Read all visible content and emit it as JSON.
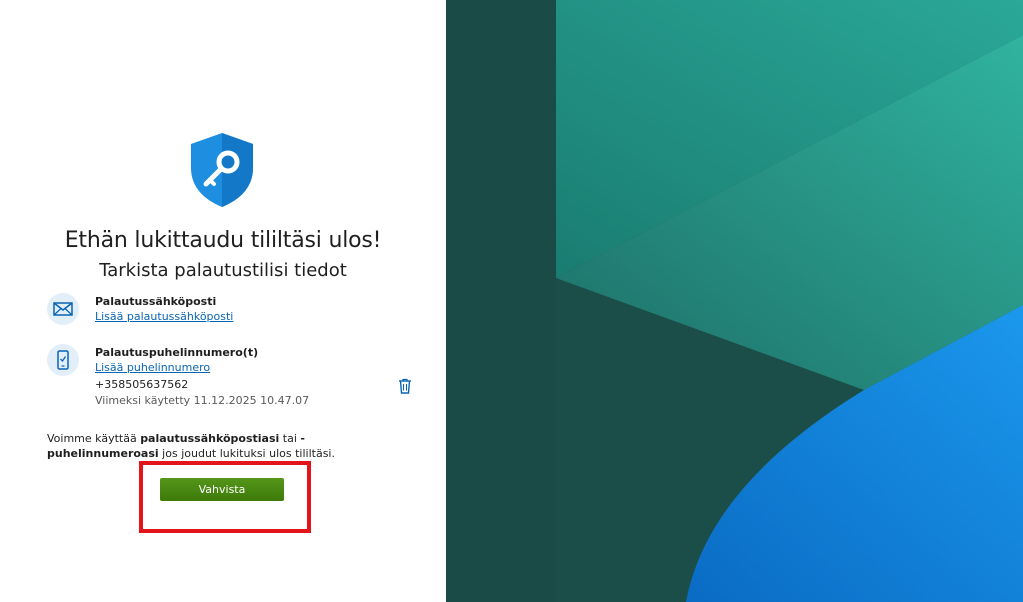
{
  "heading": "Ethän lukittaudu tililtäsi ulos!",
  "subheading": "Tarkista palautustilisi tiedot",
  "email_section": {
    "icon": "mail-icon",
    "title": "Palautussähköposti",
    "link": "Lisää palautussähköposti"
  },
  "phone_section": {
    "icon": "phone-icon",
    "title": "Palautuspuhelinnumero(t)",
    "link": "Lisää puhelinnumero",
    "number": "+358505637562",
    "last_used": "Viimeksi käytetty 11.12.2025 10.47.07",
    "delete_icon": "trash-icon"
  },
  "info": {
    "part1": "Voimme käyttää ",
    "bold1": "palautussähköpostiasi",
    "part2": " tai ",
    "bold2": "-puhelinnumeroasi",
    "part3": " jos joudut lukituksi ulos tililtäsi."
  },
  "confirm_button": "Vahvista",
  "colors": {
    "accent_blue": "#0a64b4",
    "button_green": "#4a8a12",
    "highlight_red": "#e3151a",
    "bg_dark_teal": "#1b4d49",
    "bg_teal": "#1f8f80",
    "bg_blue": "#0a7fd6"
  }
}
